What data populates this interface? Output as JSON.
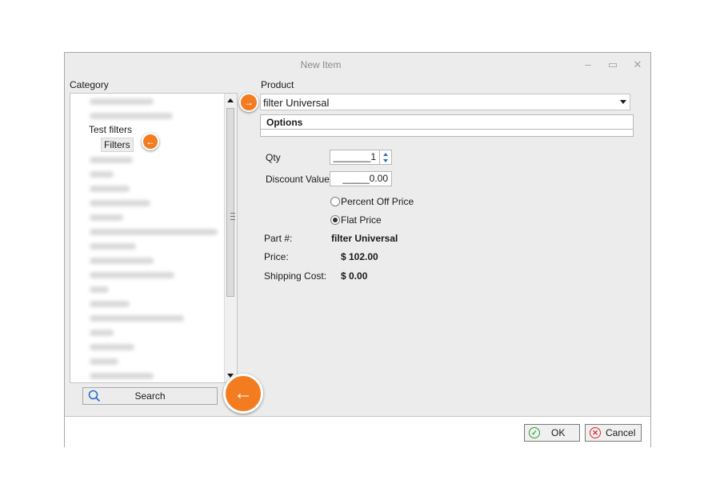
{
  "window": {
    "title": "New Item",
    "controls": [
      "–",
      "▭",
      "✕"
    ]
  },
  "category": {
    "label": "Category",
    "items": [
      {
        "label": "Test filters",
        "level": 1
      },
      {
        "label": "Filters",
        "level": 2,
        "selected": true
      }
    ]
  },
  "search": {
    "label": "Search"
  },
  "product": {
    "label": "Product",
    "value": "filter Universal",
    "options_header": "Options"
  },
  "form": {
    "qty_label": "Qty",
    "qty_value": "_______1",
    "discount_label": "Discount Value",
    "discount_value": "_____0.00",
    "percent_off_label": "Percent Off Price",
    "flat_price_label": "Flat Price",
    "flat_price_selected": true
  },
  "details": {
    "part_label": "Part #:",
    "part_value": "filter Universal",
    "price_label": "Price:",
    "price_value": "$ 102.00",
    "shipping_label": "Shipping Cost:",
    "shipping_value": "$ 0.00"
  },
  "buttons": {
    "ok": "OK",
    "cancel": "Cancel"
  },
  "colors": {
    "accent": "#f37c20",
    "ok_icon": "#2e9e3a",
    "cancel_icon": "#d9252b"
  },
  "icons": [
    "search-icon",
    "arrow-right-icon",
    "arrow-left-icon",
    "check-icon",
    "close-icon"
  ]
}
